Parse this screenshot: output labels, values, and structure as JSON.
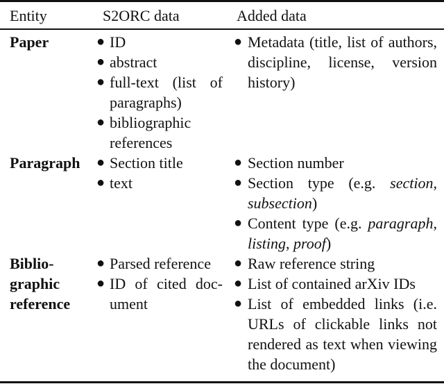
{
  "table": {
    "headers": {
      "entity": "Entity",
      "s2orc": "S2ORC data",
      "added": "Added data"
    },
    "rows": [
      {
        "entity": "Paper",
        "s2orc": [
          "ID",
          "abstract",
          "full-text (list of paragraphs)",
          "bibliographic references"
        ],
        "added": [
          {
            "text": "Metadata (title, list of au­thors, discipline, license, ver­sion history)"
          }
        ]
      },
      {
        "entity": "Paragraph",
        "s2orc": [
          "Section title",
          "text"
        ],
        "added": [
          {
            "text": "Section number"
          },
          {
            "pre": "Section type (e.g. ",
            "italic1": "section",
            "mid": ", ",
            "italic2": "subsection",
            "post": ")"
          },
          {
            "pre": "Content type (e.g. ",
            "italic1": "paragraph",
            "mid": ", ",
            "italic2": "listing",
            "mid2": ", ",
            "italic3": "proof",
            "post": ")"
          }
        ]
      },
      {
        "entity": "Biblio-graphic reference",
        "s2orc": [
          "Parsed refer­ence",
          "ID of cited doc­ument"
        ],
        "added": [
          {
            "text": "Raw reference string"
          },
          {
            "text": "List of contained arXiv IDs"
          },
          {
            "text": "List of embedded links (i.e. URLs of clickable links not rendered as text when view­ing the document)"
          }
        ]
      }
    ],
    "bullet_glyph": "●"
  }
}
